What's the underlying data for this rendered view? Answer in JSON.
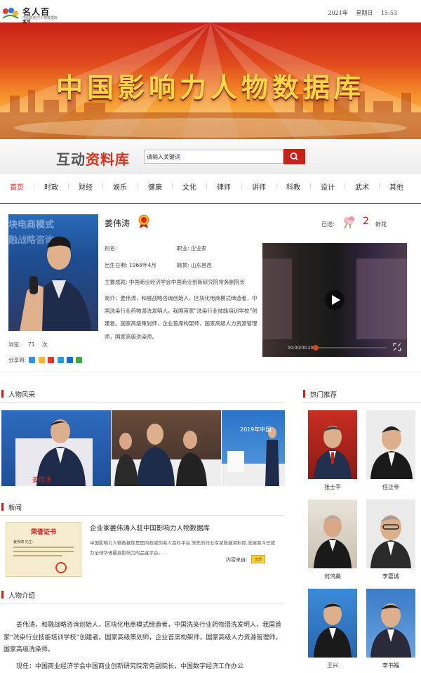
{
  "header": {
    "logo_title": "名人百科",
    "logo_subtitle": "中国影响力人物数据库",
    "date": "2021年",
    "weekday": "星期日",
    "time": "15:53"
  },
  "banner": {
    "title": "中国影响力人物数据库"
  },
  "search": {
    "brand_part1": "互动",
    "brand_part2": "资料库",
    "placeholder": "请输入关键词",
    "button_icon": "search-icon"
  },
  "nav": {
    "items": [
      "首页",
      "时政",
      "财经",
      "娱乐",
      "健康",
      "文化",
      "律师",
      "讲师",
      "科教",
      "设计",
      "武术",
      "其他"
    ],
    "active": "首页"
  },
  "profile": {
    "name": "姜伟涛",
    "alias": "别名:",
    "occupation": "职业: 企业家",
    "birth": "出生日期: 1968年4月",
    "hometown": "籍贯: 山东昌邑",
    "achievement": "主要成就: 中国商业经济学会中国商业创新研究院常务副院长",
    "summary": "简介：姜伟涛，和融战略咨询创始人，区块化电商模式缔造者，中国洗染行业药物湿洗发明人，我国首家“洗染行业技能培训学校”创建者。国家高级策划师，企业首席构架师，国家高级人力资源管理师，国家高级洗染师。",
    "views_label": "浏览:",
    "views": "71",
    "views_unit": "次",
    "share_label": "分享到:",
    "sent_label": "已送:",
    "flower_count": "2",
    "flower_label": "鲜花",
    "video_time": "00:00/00:20",
    "photo_overlay": "块电商模式",
    "photo_overlay2": "融战略咨询"
  },
  "gallery": {
    "title": "人物风采",
    "slides_text": [
      "姜伟涛",
      "2019年中国"
    ]
  },
  "news": {
    "title": "新闻",
    "item_title": "企业家姜伟涛入驻中国影响力人物数据库",
    "item_body": "中国影响力人物数据库是国内权威的名人百科平台,领先的行业专家数据资料库,发展至今已成为全球华语最具影响力的品宣平台。...",
    "source_label": "内容来自:",
    "source_badge": "优质",
    "cert_title": "荣誉证书",
    "cert_name": "姜伟涛 先生："
  },
  "intro": {
    "title": "人物介绍",
    "paragraph1": "姜伟涛，和融战略咨询创始人，区块化电商模式缔造者，中国洗染行业药物湿洗发明人，我国首家“洗染行业技能培训学校”创建者。国家高级策划师，企业首席构架师，国家高级人力资源管理师，国家高级洗染师。",
    "paragraph2": "现任：中国商业经济学会中国商业创新研究院常务副院长，中国数字经济工作办公"
  },
  "hot": {
    "title": "热门推荐",
    "people": [
      "张士平",
      "任正非",
      "何鸿燊",
      "李嘉诚",
      "王兴",
      "李书福"
    ]
  },
  "colors": {
    "brand_red": "#c9211a",
    "banner_gold": "#ffd54a"
  }
}
